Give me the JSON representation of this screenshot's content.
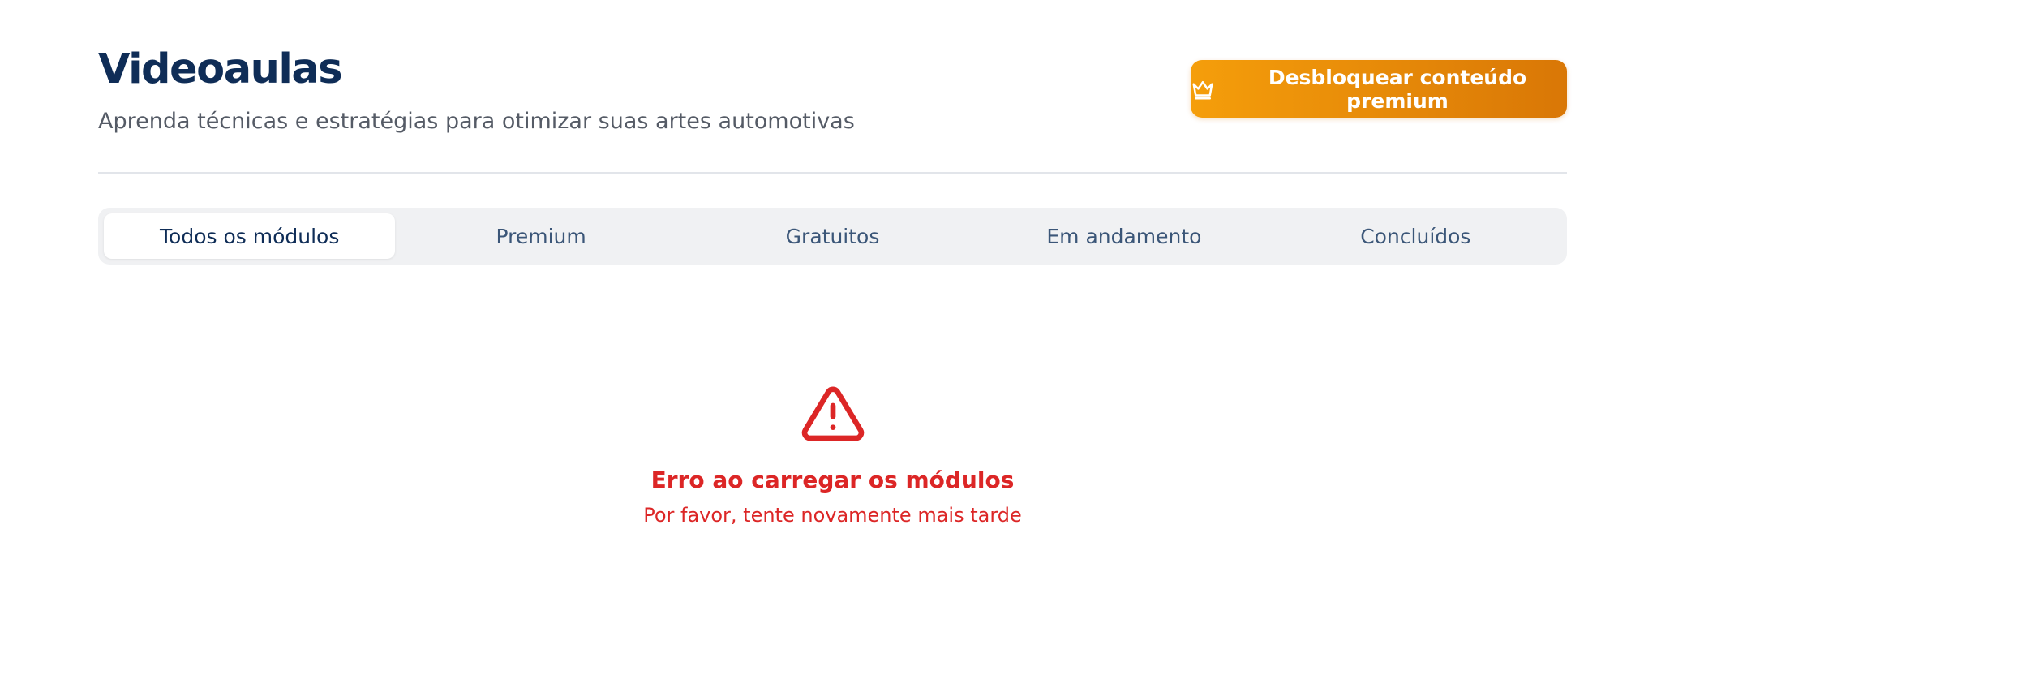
{
  "header": {
    "title": "Videoaulas",
    "subtitle": "Aprenda técnicas e estratégias para otimizar suas artes automotivas",
    "premium_button": {
      "label": "Desbloquear conteúdo premium",
      "icon": "crown-icon"
    }
  },
  "tabs": [
    {
      "label": "Todos os módulos",
      "active": true
    },
    {
      "label": "Premium",
      "active": false
    },
    {
      "label": "Gratuitos",
      "active": false
    },
    {
      "label": "Em andamento",
      "active": false
    },
    {
      "label": "Concluídos",
      "active": false
    }
  ],
  "error": {
    "icon": "warning-triangle-icon",
    "title": "Erro ao carregar os módulos",
    "message": "Por favor, tente novamente mais tarde"
  },
  "colors": {
    "title": "#0f2d57",
    "premium_gradient_start": "#f59e0b",
    "premium_gradient_end": "#d97706",
    "error": "#dc2626",
    "tabs_background": "#f0f1f3"
  }
}
